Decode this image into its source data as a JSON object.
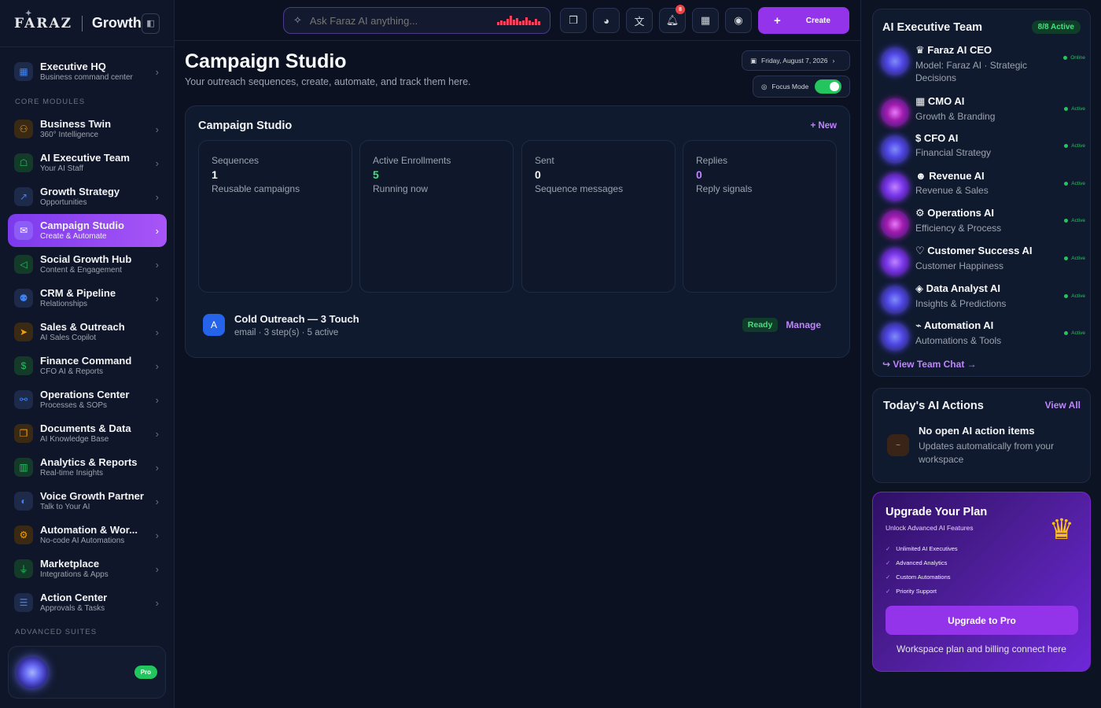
{
  "sidebar": {
    "logo": "FARAZ",
    "brand_title": "Growth",
    "collapse_icon": "panel-collapse-icon",
    "items": [
      {
        "label": "Executive HQ",
        "sub": "Business command center",
        "icon": "grid-icon",
        "color": "#3b82f6",
        "bg": "#1e2a4a"
      },
      {
        "label": "Business Twin",
        "sub": "360° Intelligence",
        "icon": "network-icon",
        "color": "#f59e0b",
        "bg": "#3a2a14"
      },
      {
        "label": "AI Executive Team",
        "sub": "Your AI Staff",
        "icon": "bot-icon",
        "color": "#22c55e",
        "bg": "#143a2a"
      },
      {
        "label": "Growth Strategy",
        "sub": "Opportunities",
        "icon": "trend-icon",
        "color": "#3b82f6",
        "bg": "#1e2a4a"
      },
      {
        "label": "Campaign Studio",
        "sub": "Create & Automate",
        "icon": "mail-icon",
        "color": "#ffffff",
        "bg": "#8b5cf6"
      },
      {
        "label": "Social Growth Hub",
        "sub": "Content & Engagement",
        "icon": "megaphone-icon",
        "color": "#22c55e",
        "bg": "#143a2a"
      },
      {
        "label": "CRM & Pipeline",
        "sub": "Relationships",
        "icon": "users-icon",
        "color": "#3b82f6",
        "bg": "#1e2a4a"
      },
      {
        "label": "Sales & Outreach",
        "sub": "AI Sales Copilot",
        "icon": "send-icon",
        "color": "#f59e0b",
        "bg": "#3a2a14"
      },
      {
        "label": "Finance Command",
        "sub": "CFO AI & Reports",
        "icon": "dollar-icon",
        "color": "#22c55e",
        "bg": "#143a2a"
      },
      {
        "label": "Operations Center",
        "sub": "Processes & SOPs",
        "icon": "workflow-icon",
        "color": "#3b82f6",
        "bg": "#1e2a4a"
      },
      {
        "label": "Documents & Data",
        "sub": "AI Knowledge Base",
        "icon": "documents-icon",
        "color": "#f59e0b",
        "bg": "#3a2a14"
      },
      {
        "label": "Analytics & Reports",
        "sub": "Real-time Insights",
        "icon": "bar-chart-icon",
        "color": "#22c55e",
        "bg": "#143a2a"
      },
      {
        "label": "Voice Growth Partner",
        "sub": "Talk to Your AI",
        "icon": "microphone-icon",
        "color": "#3b82f6",
        "bg": "#1e2a4a"
      },
      {
        "label": "Automation & Wor...",
        "sub": "No-code AI Automations",
        "icon": "automation-icon",
        "color": "#f59e0b",
        "bg": "#3a2a14"
      },
      {
        "label": "Marketplace",
        "sub": "Integrations & Apps",
        "icon": "plug-icon",
        "color": "#22c55e",
        "bg": "#143a2a"
      },
      {
        "label": "Action Center",
        "sub": "Approvals & Tasks",
        "icon": "checklist-icon",
        "color": "#3b82f6",
        "bg": "#1e2a4a"
      }
    ],
    "section_core": "CORE MODULES",
    "section_advanced": "ADVANCED SUITES",
    "profile_badge": "Pro"
  },
  "topbar": {
    "search_placeholder": "Ask Faraz AI anything...",
    "notification_count": "8",
    "create_label": "Create",
    "icons": [
      "book-icon",
      "palette-icon",
      "translate-icon",
      "bell-icon",
      "calendar-icon",
      "user-circle-icon"
    ]
  },
  "header": {
    "title": "Campaign Studio",
    "subtitle": "Your outreach sequences, create, automate, and track them here.",
    "date": "Friday, August 7, 2026",
    "focus_mode": "Focus Mode",
    "focus_on": true
  },
  "studio": {
    "title": "Campaign Studio",
    "new_link": "+ New",
    "stats": [
      {
        "label": "Sequences",
        "value": "1",
        "sub": "Reusable campaigns",
        "color": "#f3f4f6"
      },
      {
        "label": "Active Enrollments",
        "value": "5",
        "sub": "Running now",
        "color": "#4ade80"
      },
      {
        "label": "Sent",
        "value": "0",
        "sub": "Sequence messages",
        "color": "#f3f4f6"
      },
      {
        "label": "Replies",
        "value": "0",
        "sub": "Reply signals",
        "color": "#c084fc"
      }
    ],
    "campaign": {
      "avatar": "A",
      "name": "Cold Outreach — 3 Touch",
      "meta": "email · 3 step(s) · 5 active",
      "status": "Ready",
      "action": "Manage"
    }
  },
  "team": {
    "title": "AI Executive Team",
    "badge": "8/8 Active",
    "members": [
      {
        "name": "♛ Faraz AI CEO",
        "desc": "Model: Faraz AI · Strategic Decisions",
        "status": "Online",
        "orb": "blue"
      },
      {
        "name": "▦ CMO AI",
        "desc": "Growth & Branding",
        "status": "Active",
        "orb": "pink"
      },
      {
        "name": "$ CFO AI",
        "desc": "Financial Strategy",
        "status": "Active",
        "orb": "blue"
      },
      {
        "name": "☻ Revenue AI",
        "desc": "Revenue & Sales",
        "status": "Active",
        "orb": "violet"
      },
      {
        "name": "⚙ Operations AI",
        "desc": "Efficiency & Process",
        "status": "Active",
        "orb": "pink"
      },
      {
        "name": "♡ Customer Success AI",
        "desc": "Customer Happiness",
        "status": "Active",
        "orb": "violet"
      },
      {
        "name": "◈ Data Analyst AI",
        "desc": "Insights & Predictions",
        "status": "Active",
        "orb": "blue"
      },
      {
        "name": "⌁ Automation AI",
        "desc": "Automations & Tools",
        "status": "Active",
        "orb": "blue"
      }
    ],
    "link": "↪ View Team Chat →"
  },
  "actions": {
    "title": "Today's AI Actions",
    "view_all": "View All",
    "empty_title": "No open AI action items",
    "empty_desc": "Updates automatically from your workspace"
  },
  "upgrade": {
    "title": "Upgrade Your Plan",
    "subtitle": "Unlock Advanced AI Features",
    "features": [
      "Unlimited AI Executives",
      "Advanced Analytics",
      "Custom Automations",
      "Priority Support"
    ],
    "button": "Upgrade to Pro",
    "note": "Workspace plan and billing connect here"
  }
}
